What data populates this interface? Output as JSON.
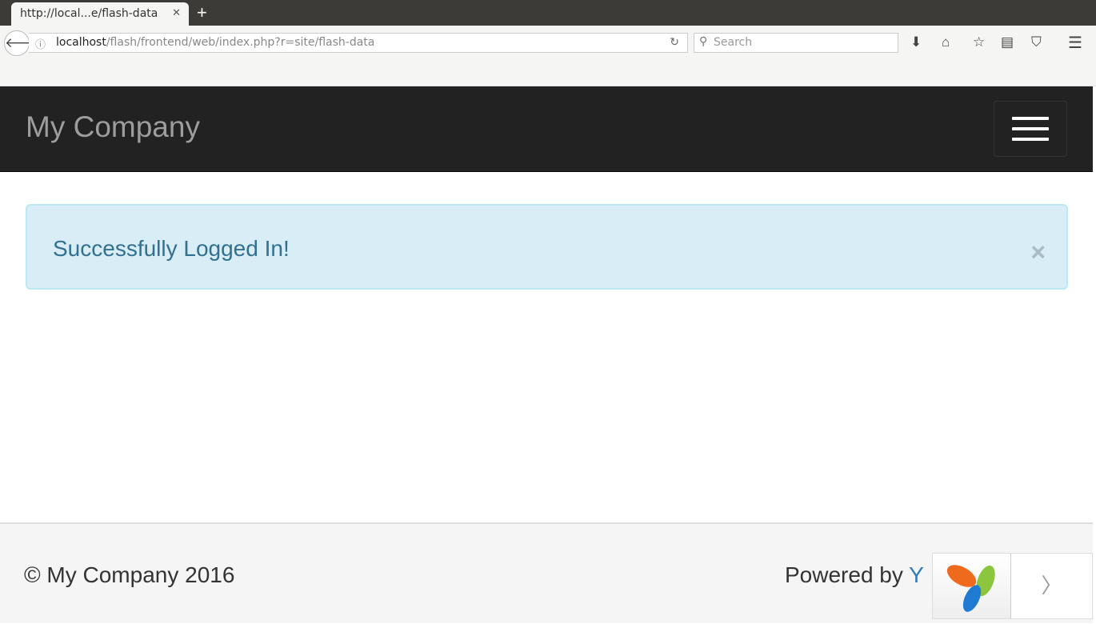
{
  "browser": {
    "tab_title": "http://local...e/flash-data",
    "url_host": "localhost",
    "url_path": "/flash/frontend/web/index.php?r=site/flash-data",
    "search_placeholder": "Search"
  },
  "site": {
    "brand": "My Company",
    "alert_message": "Successfully Logged In!",
    "alert_close": "×",
    "footer_copyright": "© My Company 2016",
    "footer_powered": "Powered by ",
    "footer_powered_link": "Y"
  },
  "colors": {
    "navbar": "#222222",
    "alert_bg": "#d9edf7",
    "alert_text": "#31708f",
    "link": "#337ab7"
  }
}
